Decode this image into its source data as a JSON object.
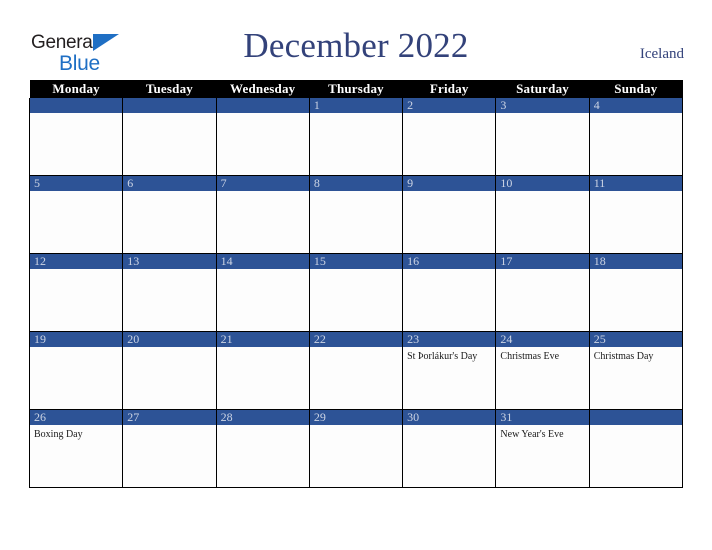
{
  "brand": {
    "name_top": "General",
    "name_bottom": "Blue",
    "triangle_color": "#1f6fc4",
    "text_color": "#231f20"
  },
  "header": {
    "title": "December 2022",
    "region": "Iceland",
    "title_color": "#33427a"
  },
  "colors": {
    "header_row_bg": "#000000",
    "header_row_text": "#ffffff",
    "day_bar_bg": "#2d5396",
    "day_number_text": "#ccd4e4",
    "cell_bg": "#fdfdfd",
    "grid_line": "#000000"
  },
  "weekday_headers": [
    "Monday",
    "Tuesday",
    "Wednesday",
    "Thursday",
    "Friday",
    "Saturday",
    "Sunday"
  ],
  "weeks": [
    [
      {
        "day": "",
        "events": []
      },
      {
        "day": "",
        "events": []
      },
      {
        "day": "",
        "events": []
      },
      {
        "day": "1",
        "events": []
      },
      {
        "day": "2",
        "events": []
      },
      {
        "day": "3",
        "events": []
      },
      {
        "day": "4",
        "events": []
      }
    ],
    [
      {
        "day": "5",
        "events": []
      },
      {
        "day": "6",
        "events": []
      },
      {
        "day": "7",
        "events": []
      },
      {
        "day": "8",
        "events": []
      },
      {
        "day": "9",
        "events": []
      },
      {
        "day": "10",
        "events": []
      },
      {
        "day": "11",
        "events": []
      }
    ],
    [
      {
        "day": "12",
        "events": []
      },
      {
        "day": "13",
        "events": []
      },
      {
        "day": "14",
        "events": []
      },
      {
        "day": "15",
        "events": []
      },
      {
        "day": "16",
        "events": []
      },
      {
        "day": "17",
        "events": []
      },
      {
        "day": "18",
        "events": []
      }
    ],
    [
      {
        "day": "19",
        "events": []
      },
      {
        "day": "20",
        "events": []
      },
      {
        "day": "21",
        "events": []
      },
      {
        "day": "22",
        "events": []
      },
      {
        "day": "23",
        "events": [
          "St Þorlákur's Day"
        ]
      },
      {
        "day": "24",
        "events": [
          "Christmas Eve"
        ]
      },
      {
        "day": "25",
        "events": [
          "Christmas Day"
        ]
      }
    ],
    [
      {
        "day": "26",
        "events": [
          "Boxing Day"
        ]
      },
      {
        "day": "27",
        "events": []
      },
      {
        "day": "28",
        "events": []
      },
      {
        "day": "29",
        "events": []
      },
      {
        "day": "30",
        "events": []
      },
      {
        "day": "31",
        "events": [
          "New Year's Eve"
        ]
      },
      {
        "day": "",
        "events": []
      }
    ]
  ]
}
